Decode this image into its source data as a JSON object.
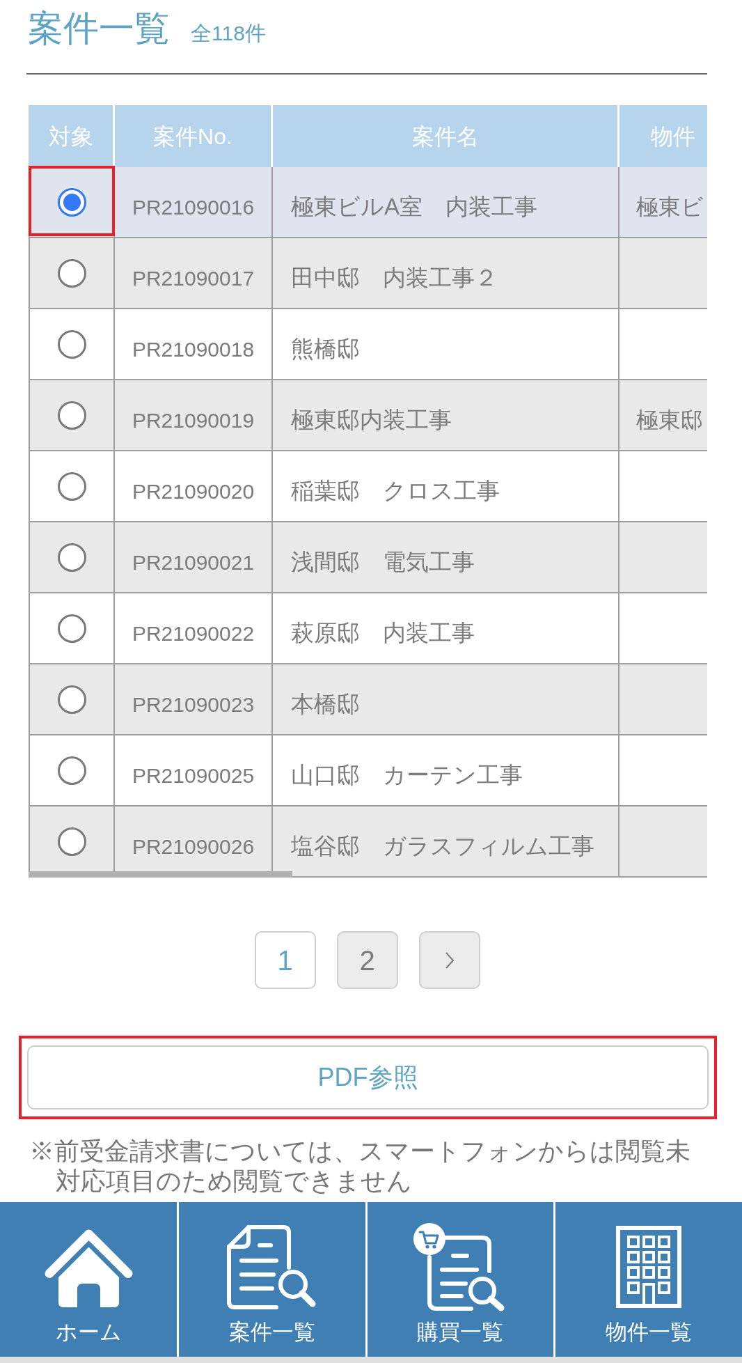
{
  "page_title": "案件一覧",
  "total_count": "全118件",
  "table": {
    "columns": [
      "対象",
      "案件No.",
      "案件名",
      "物件"
    ],
    "rows": [
      {
        "selected": true,
        "highlighted": true,
        "number": "PR21090016",
        "name": "極東ビルA室　内装工事",
        "column_4": "極東ビ"
      },
      {
        "selected": false,
        "highlighted": false,
        "number": "PR21090017",
        "name": "田中邸　内装工事２"
      },
      {
        "selected": false,
        "highlighted": false,
        "number": "PR21090018",
        "name": "熊橋邸"
      },
      {
        "selected": false,
        "highlighted": false,
        "number": "PR21090019",
        "name": "極東邸内装工事",
        "column_4": "極東邸"
      },
      {
        "selected": false,
        "highlighted": false,
        "number": "PR21090020",
        "name": "稲葉邸　クロス工事"
      },
      {
        "selected": false,
        "highlighted": false,
        "number": "PR21090021",
        "name": "浅間邸　電気工事"
      },
      {
        "selected": false,
        "highlighted": false,
        "number": "PR21090022",
        "name": "萩原邸　内装工事"
      },
      {
        "selected": false,
        "highlighted": false,
        "number": "PR21090023",
        "name": "本橋邸"
      },
      {
        "selected": false,
        "highlighted": false,
        "number": "PR21090025",
        "name": "山口邸　カーテン工事"
      },
      {
        "selected": false,
        "highlighted": false,
        "number": "PR21090026",
        "name": "塩谷邸　ガラスフィルム工事"
      }
    ]
  },
  "pagination": [
    {
      "kind": "page",
      "label": "1",
      "selected": true
    },
    {
      "kind": "page",
      "label": "2",
      "selected": false
    },
    {
      "kind": "next",
      "selected": false
    }
  ],
  "pdf_button": {
    "label": "PDF参照",
    "highlighted": true
  },
  "notice": "※前受金請求書については、スマートフォンからは閲覧未対応項目のため閲覧できません",
  "bottom_nav": [
    {
      "kind": "home",
      "label": "ホーム"
    },
    {
      "kind": "projects",
      "label": "案件一覧"
    },
    {
      "kind": "purchases",
      "label": "購買一覧"
    },
    {
      "kind": "properties",
      "label": "物件一覧"
    }
  ]
}
